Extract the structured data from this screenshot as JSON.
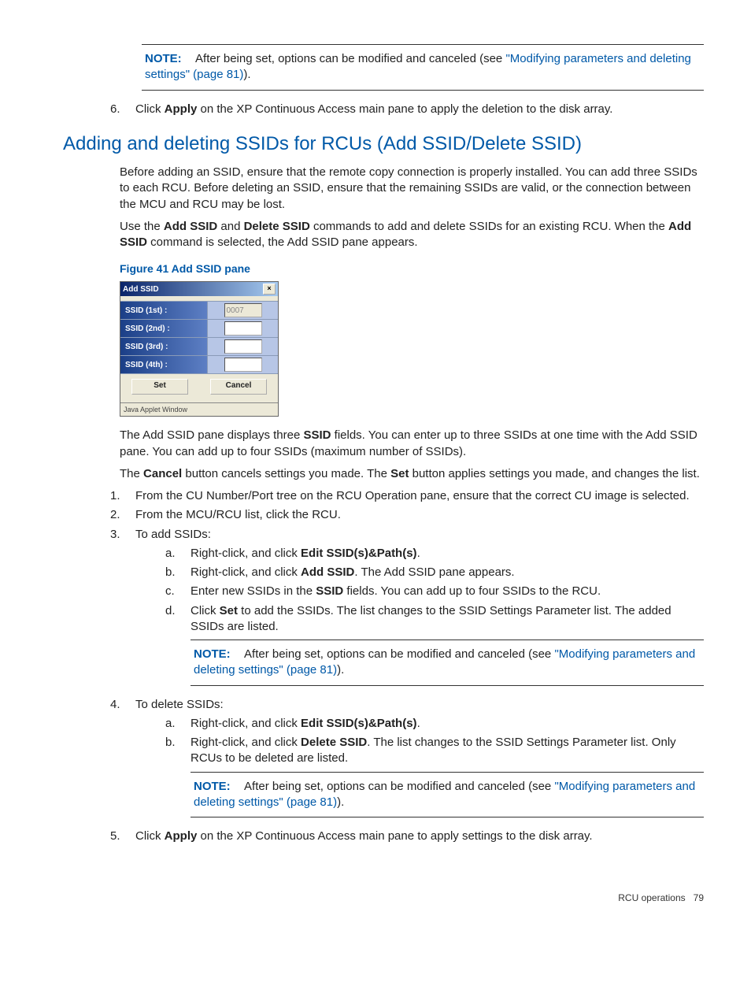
{
  "note_top": {
    "label": "NOTE:",
    "text_before": "After being set, options can be modified and canceled (see ",
    "link": "\"Modifying parameters and deleting settings\" (page 81)",
    "text_after": ")."
  },
  "step6": {
    "marker": "6.",
    "text_a": "Click ",
    "bold": "Apply",
    "text_b": " on the XP Continuous Access main pane to apply the deletion to the disk array."
  },
  "heading": "Adding and deleting SSIDs for RCUs (Add SSID/Delete SSID)",
  "para1": "Before adding an SSID, ensure that the remote copy connection is properly installed. You can add three SSIDs to each RCU. Before deleting an SSID, ensure that the remaining SSIDs are valid, or the connection between the MCU and RCU may be lost.",
  "para2": {
    "a": "Use the ",
    "b1": "Add SSID",
    "c": " and ",
    "b2": "Delete SSID",
    "d": " commands to add and delete SSIDs for an existing RCU. When the ",
    "b3": "Add SSID",
    "e": " command is selected, the Add SSID pane appears."
  },
  "figure_caption": "Figure 41 Add SSID pane",
  "dialog": {
    "title": "Add SSID",
    "rows": [
      {
        "label": "SSID (1st) :",
        "value": "0007",
        "disabled": true
      },
      {
        "label": "SSID (2nd) :",
        "value": "",
        "disabled": false
      },
      {
        "label": "SSID (3rd) :",
        "value": "",
        "disabled": false
      },
      {
        "label": "SSID (4th) :",
        "value": "",
        "disabled": false
      }
    ],
    "set": "Set",
    "cancel": "Cancel",
    "status": "Java Applet Window"
  },
  "para3": {
    "a": "The Add SSID pane displays three ",
    "b": "SSID",
    "c": " fields. You can enter up to three SSIDs at one time with the Add SSID pane. You can add up to four SSIDs (maximum number of SSIDs)."
  },
  "para4": {
    "a": "The ",
    "b1": "Cancel",
    "c": " button cancels settings you made. The ",
    "b2": "Set",
    "d": " button applies settings you made, and changes the list."
  },
  "steps": {
    "s1": {
      "m": "1.",
      "t": "From the CU Number/Port tree on the RCU Operation pane, ensure that the correct CU image is selected."
    },
    "s2": {
      "m": "2.",
      "t": "From the MCU/RCU list, click the RCU."
    },
    "s3": {
      "m": "3.",
      "t": "To add SSIDs:"
    },
    "s3a": {
      "m": "a.",
      "a": "Right-click, and click ",
      "b": "Edit SSID(s)&Path(s)",
      "c": "."
    },
    "s3b": {
      "m": "b.",
      "a": "Right-click, and click ",
      "b": "Add SSID",
      "c": ". The Add SSID pane appears."
    },
    "s3c": {
      "m": "c.",
      "a": "Enter new SSIDs in the ",
      "b": "SSID",
      "c": " fields. You can add up to four SSIDs to the RCU."
    },
    "s3d": {
      "m": "d.",
      "a": "Click ",
      "b": "Set",
      "c": " to add the SSIDs. The list changes to the SSID Settings Parameter list. The added SSIDs are listed."
    },
    "s3note": {
      "label": "NOTE:",
      "text_before": "After being set, options can be modified and canceled (see ",
      "link": "\"Modifying parameters and deleting settings\" (page 81)",
      "text_after": ")."
    },
    "s4": {
      "m": "4.",
      "t": "To delete SSIDs:"
    },
    "s4a": {
      "m": "a.",
      "a": "Right-click, and click ",
      "b": "Edit SSID(s)&Path(s)",
      "c": "."
    },
    "s4b": {
      "m": "b.",
      "a": "Right-click, and click ",
      "b": "Delete SSID",
      "c": ". The list changes to the SSID Settings Parameter list. Only RCUs to be deleted are listed."
    },
    "s4note": {
      "label": "NOTE:",
      "text_before": "After being set, options can be modified and canceled (see ",
      "link": "\"Modifying parameters and deleting settings\" (page 81)",
      "text_after": ")."
    },
    "s5": {
      "m": "5.",
      "a": "Click ",
      "b": "Apply",
      "c": " on the XP Continuous Access main pane to apply settings to the disk array."
    }
  },
  "footer": {
    "section": "RCU operations",
    "page": "79"
  }
}
